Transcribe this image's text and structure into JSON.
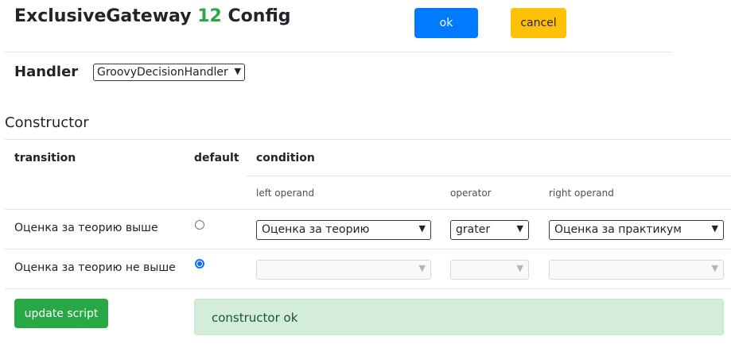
{
  "header": {
    "title_prefix": "ExclusiveGateway",
    "title_number": "12",
    "title_suffix": "Config",
    "ok_label": "ok",
    "cancel_label": "cancel"
  },
  "handler": {
    "label": "Handler",
    "selected": "GroovyDecisionHandler"
  },
  "constructor": {
    "heading": "Constructor",
    "columns": {
      "transition": "transition",
      "default": "default",
      "condition": "condition",
      "left_operand": "left operand",
      "operator": "operator",
      "right_operand": "right operand"
    },
    "rows": [
      {
        "transition": "Оценка за теорию выше",
        "default": false,
        "left_operand": "Оценка за теорию",
        "operator": "grater",
        "right_operand": "Оценка за практикум",
        "enabled": true
      },
      {
        "transition": "Оценка за теорию не выше",
        "default": true,
        "left_operand": "",
        "operator": "",
        "right_operand": "",
        "enabled": false
      }
    ],
    "update_label": "update script",
    "status": "constructor ok"
  },
  "icons": {
    "dropdown": "chevron-down-icon"
  },
  "colors": {
    "primary": "#007bff",
    "warning": "#ffc107",
    "success": "#28a745",
    "success_light": "#d4edda",
    "number_green": "#28a745"
  }
}
